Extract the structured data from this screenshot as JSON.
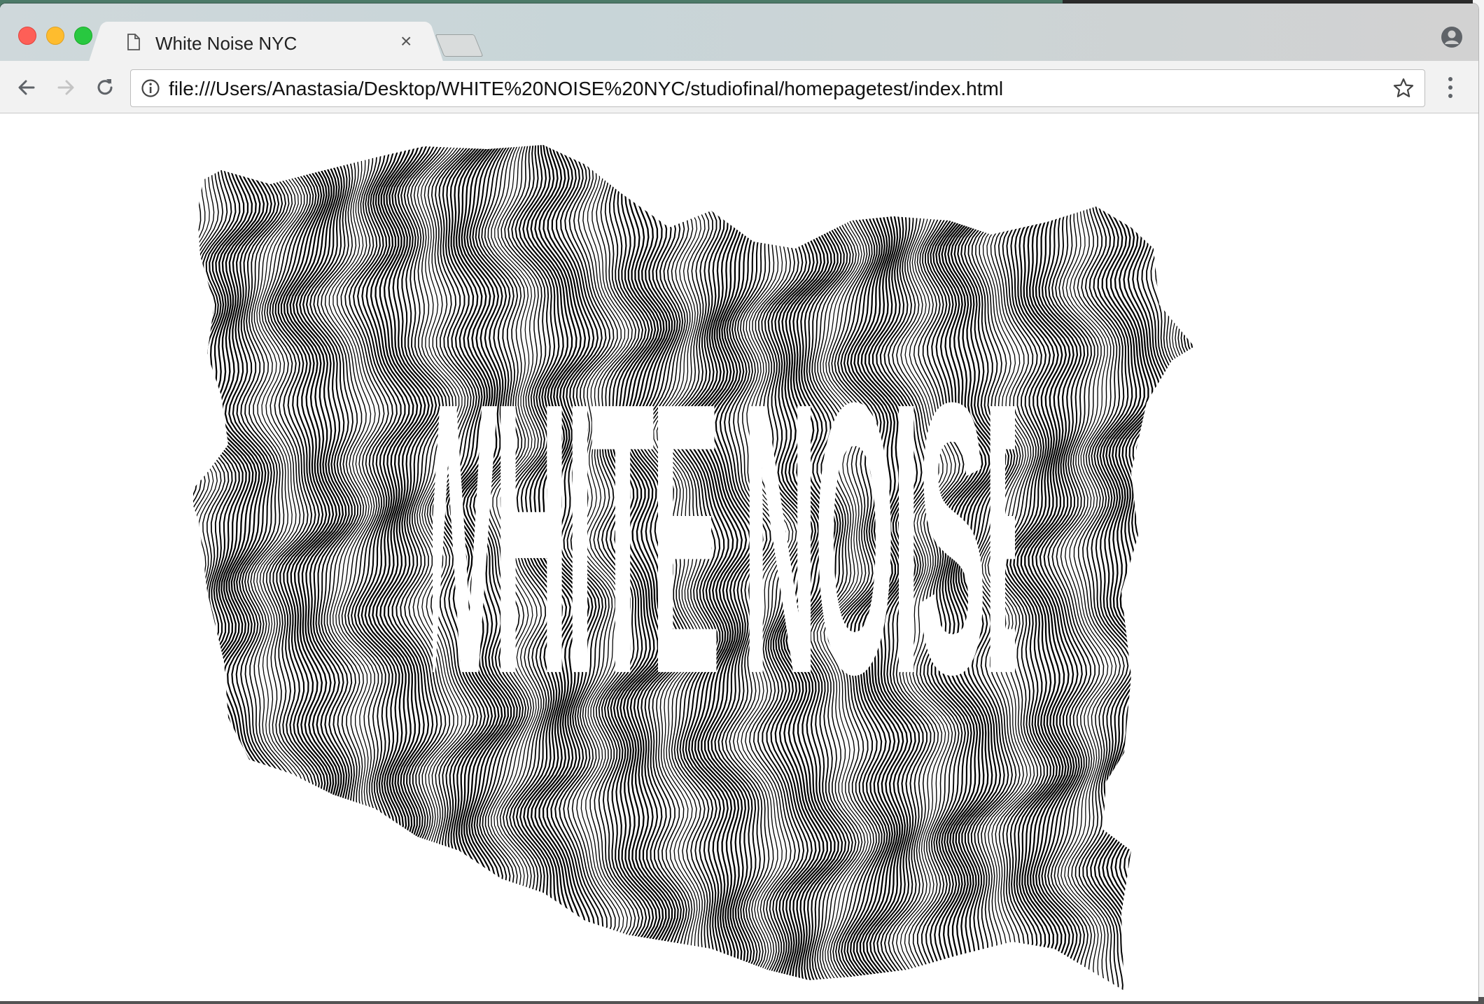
{
  "browser": {
    "tab": {
      "title": "White Noise NYC",
      "icon": "document-icon",
      "close_glyph": "×"
    },
    "address_bar": {
      "url": "file:///Users/Anastasia/Desktop/WHITE%20NOISE%20NYC/studiofinal/homepagetest/index.html"
    },
    "controls": {
      "back": "back-arrow-icon",
      "forward": "forward-arrow-icon",
      "reload": "reload-icon",
      "info": "info-icon",
      "bookmark": "star-icon",
      "menu": "kebab-menu-icon",
      "profile": "profile-icon"
    }
  },
  "page": {
    "hero_title": "WHITE NOISE",
    "colors": {
      "background": "#ffffff",
      "art": "#000000",
      "title": "#ffffff"
    }
  }
}
